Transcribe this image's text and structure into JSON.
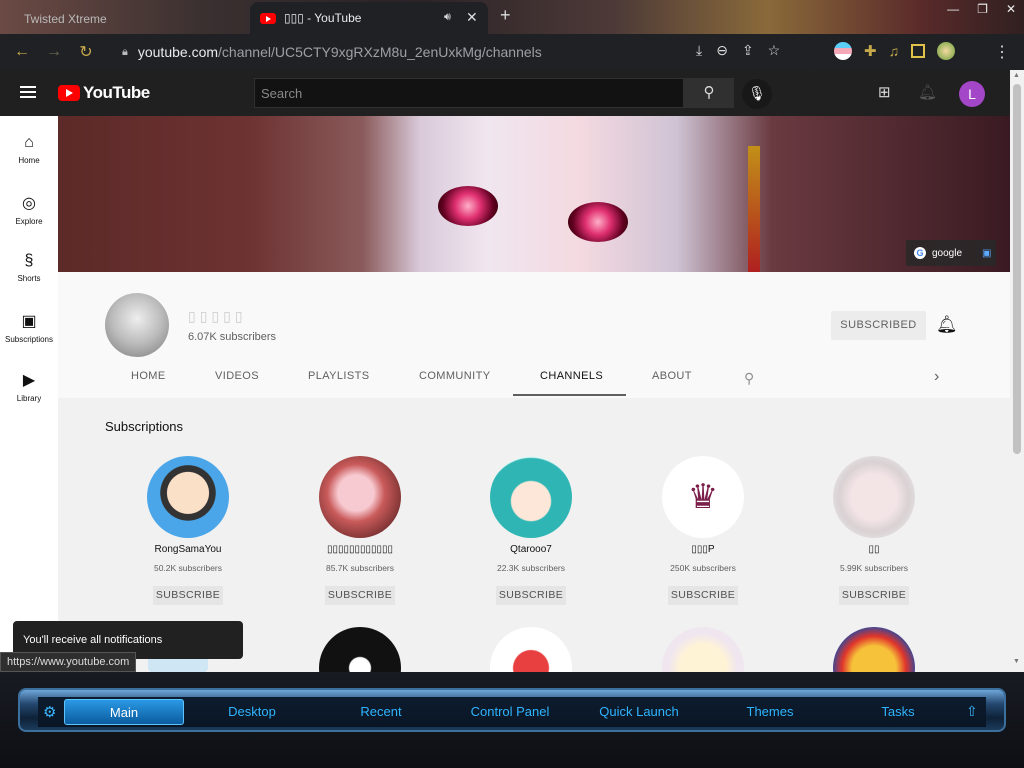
{
  "browser": {
    "tab_inactive_title": "Twisted Xtreme",
    "tab_active_title": "▯▯▯ - YouTube",
    "url_domain": "youtube.com",
    "url_path": "/channel/UC5CTY9xgRXzM8u_2enUxkMg/channels"
  },
  "youtube": {
    "logo_text": "YouTube",
    "search_placeholder": "Search",
    "avatar_letter": "L",
    "sidebar": [
      {
        "label": "Home",
        "icon": "⌂"
      },
      {
        "label": "Explore",
        "icon": "◎"
      },
      {
        "label": "Shorts",
        "icon": "§"
      },
      {
        "label": "Subscriptions",
        "icon": "▣"
      },
      {
        "label": "Library",
        "icon": "▶"
      }
    ],
    "banner_tag": "google",
    "channel": {
      "name": "▯▯▯▯▯",
      "subscribers": "6.07K subscribers",
      "subscribed_label": "SUBSCRIBED"
    },
    "tabs": [
      "HOME",
      "VIDEOS",
      "PLAYLISTS",
      "COMMUNITY",
      "CHANNELS",
      "ABOUT"
    ],
    "active_tab": "CHANNELS",
    "section_title": "Subscriptions",
    "subscriptions": [
      {
        "name": "RongSamaYou",
        "subs": "50.2K subscribers",
        "button": "SUBSCRIBE"
      },
      {
        "name": "▯▯▯▯▯▯▯▯▯▯▯▯",
        "subs": "85.7K subscribers",
        "button": "SUBSCRIBE"
      },
      {
        "name": "Qtarooo7",
        "subs": "22.3K subscribers",
        "button": "SUBSCRIBE"
      },
      {
        "name": "▯▯▯P",
        "subs": "250K subscribers",
        "button": "SUBSCRIBE"
      },
      {
        "name": "▯▯",
        "subs": "5.99K subscribers",
        "button": "SUBSCRIBE"
      }
    ],
    "toast": "You'll receive all notifications",
    "status_url": "https://www.youtube.com"
  },
  "dock": {
    "items": [
      "Main",
      "Desktop",
      "Recent",
      "Control Panel",
      "Quick Launch",
      "Themes",
      "Tasks"
    ],
    "active": "Main"
  },
  "colors": {
    "youtube_red": "#ff0000",
    "avatar_purple": "#a346c7",
    "dock_accent": "#2fb4ff"
  }
}
